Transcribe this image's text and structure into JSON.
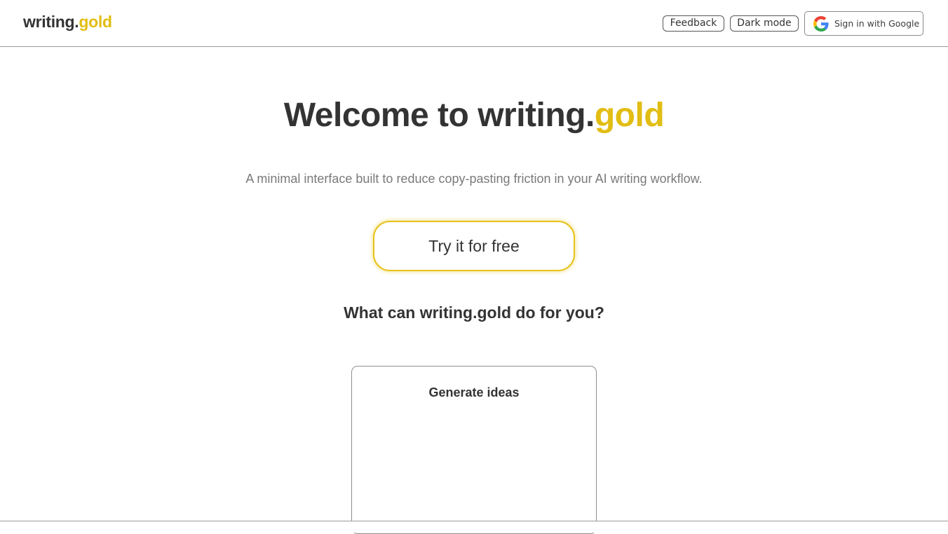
{
  "header": {
    "logo_main": "writing.",
    "logo_accent": "gold",
    "feedback_label": "Feedback",
    "dark_mode_label": "Dark mode",
    "google_signin_label": "Sign in with Google",
    "google_icon": "google-g-icon"
  },
  "hero": {
    "title_main": "Welcome to writing.",
    "title_accent": "gold",
    "subtitle": "A minimal interface built to reduce copy-pasting friction in your AI writing workflow.",
    "cta_label": "Try it for free"
  },
  "features": {
    "section_title": "What can writing.gold do for you?",
    "cards": [
      {
        "title": "Generate ideas"
      }
    ]
  },
  "colors": {
    "accent": "#e2bd12",
    "text": "#333333",
    "muted": "#7a7a7a"
  }
}
